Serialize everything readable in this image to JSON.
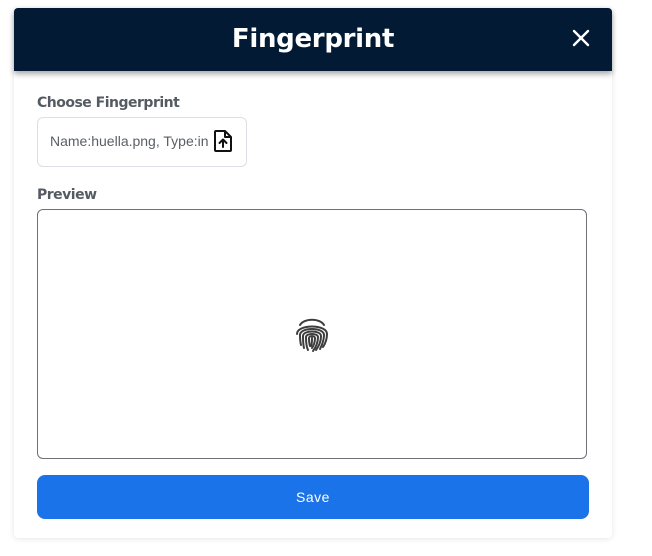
{
  "modal": {
    "title": "Fingerprint",
    "close_icon": "close-icon"
  },
  "choose_fingerprint": {
    "label": "Choose Fingerprint",
    "value": "Name:huella.png, Type:in",
    "icon": "file-upload-icon"
  },
  "preview": {
    "label": "Preview",
    "icon": "fingerprint-icon"
  },
  "actions": {
    "save_label": "Save"
  },
  "colors": {
    "header_bg": "#021a33",
    "primary": "#1a73e8",
    "label_text": "#555b63"
  }
}
